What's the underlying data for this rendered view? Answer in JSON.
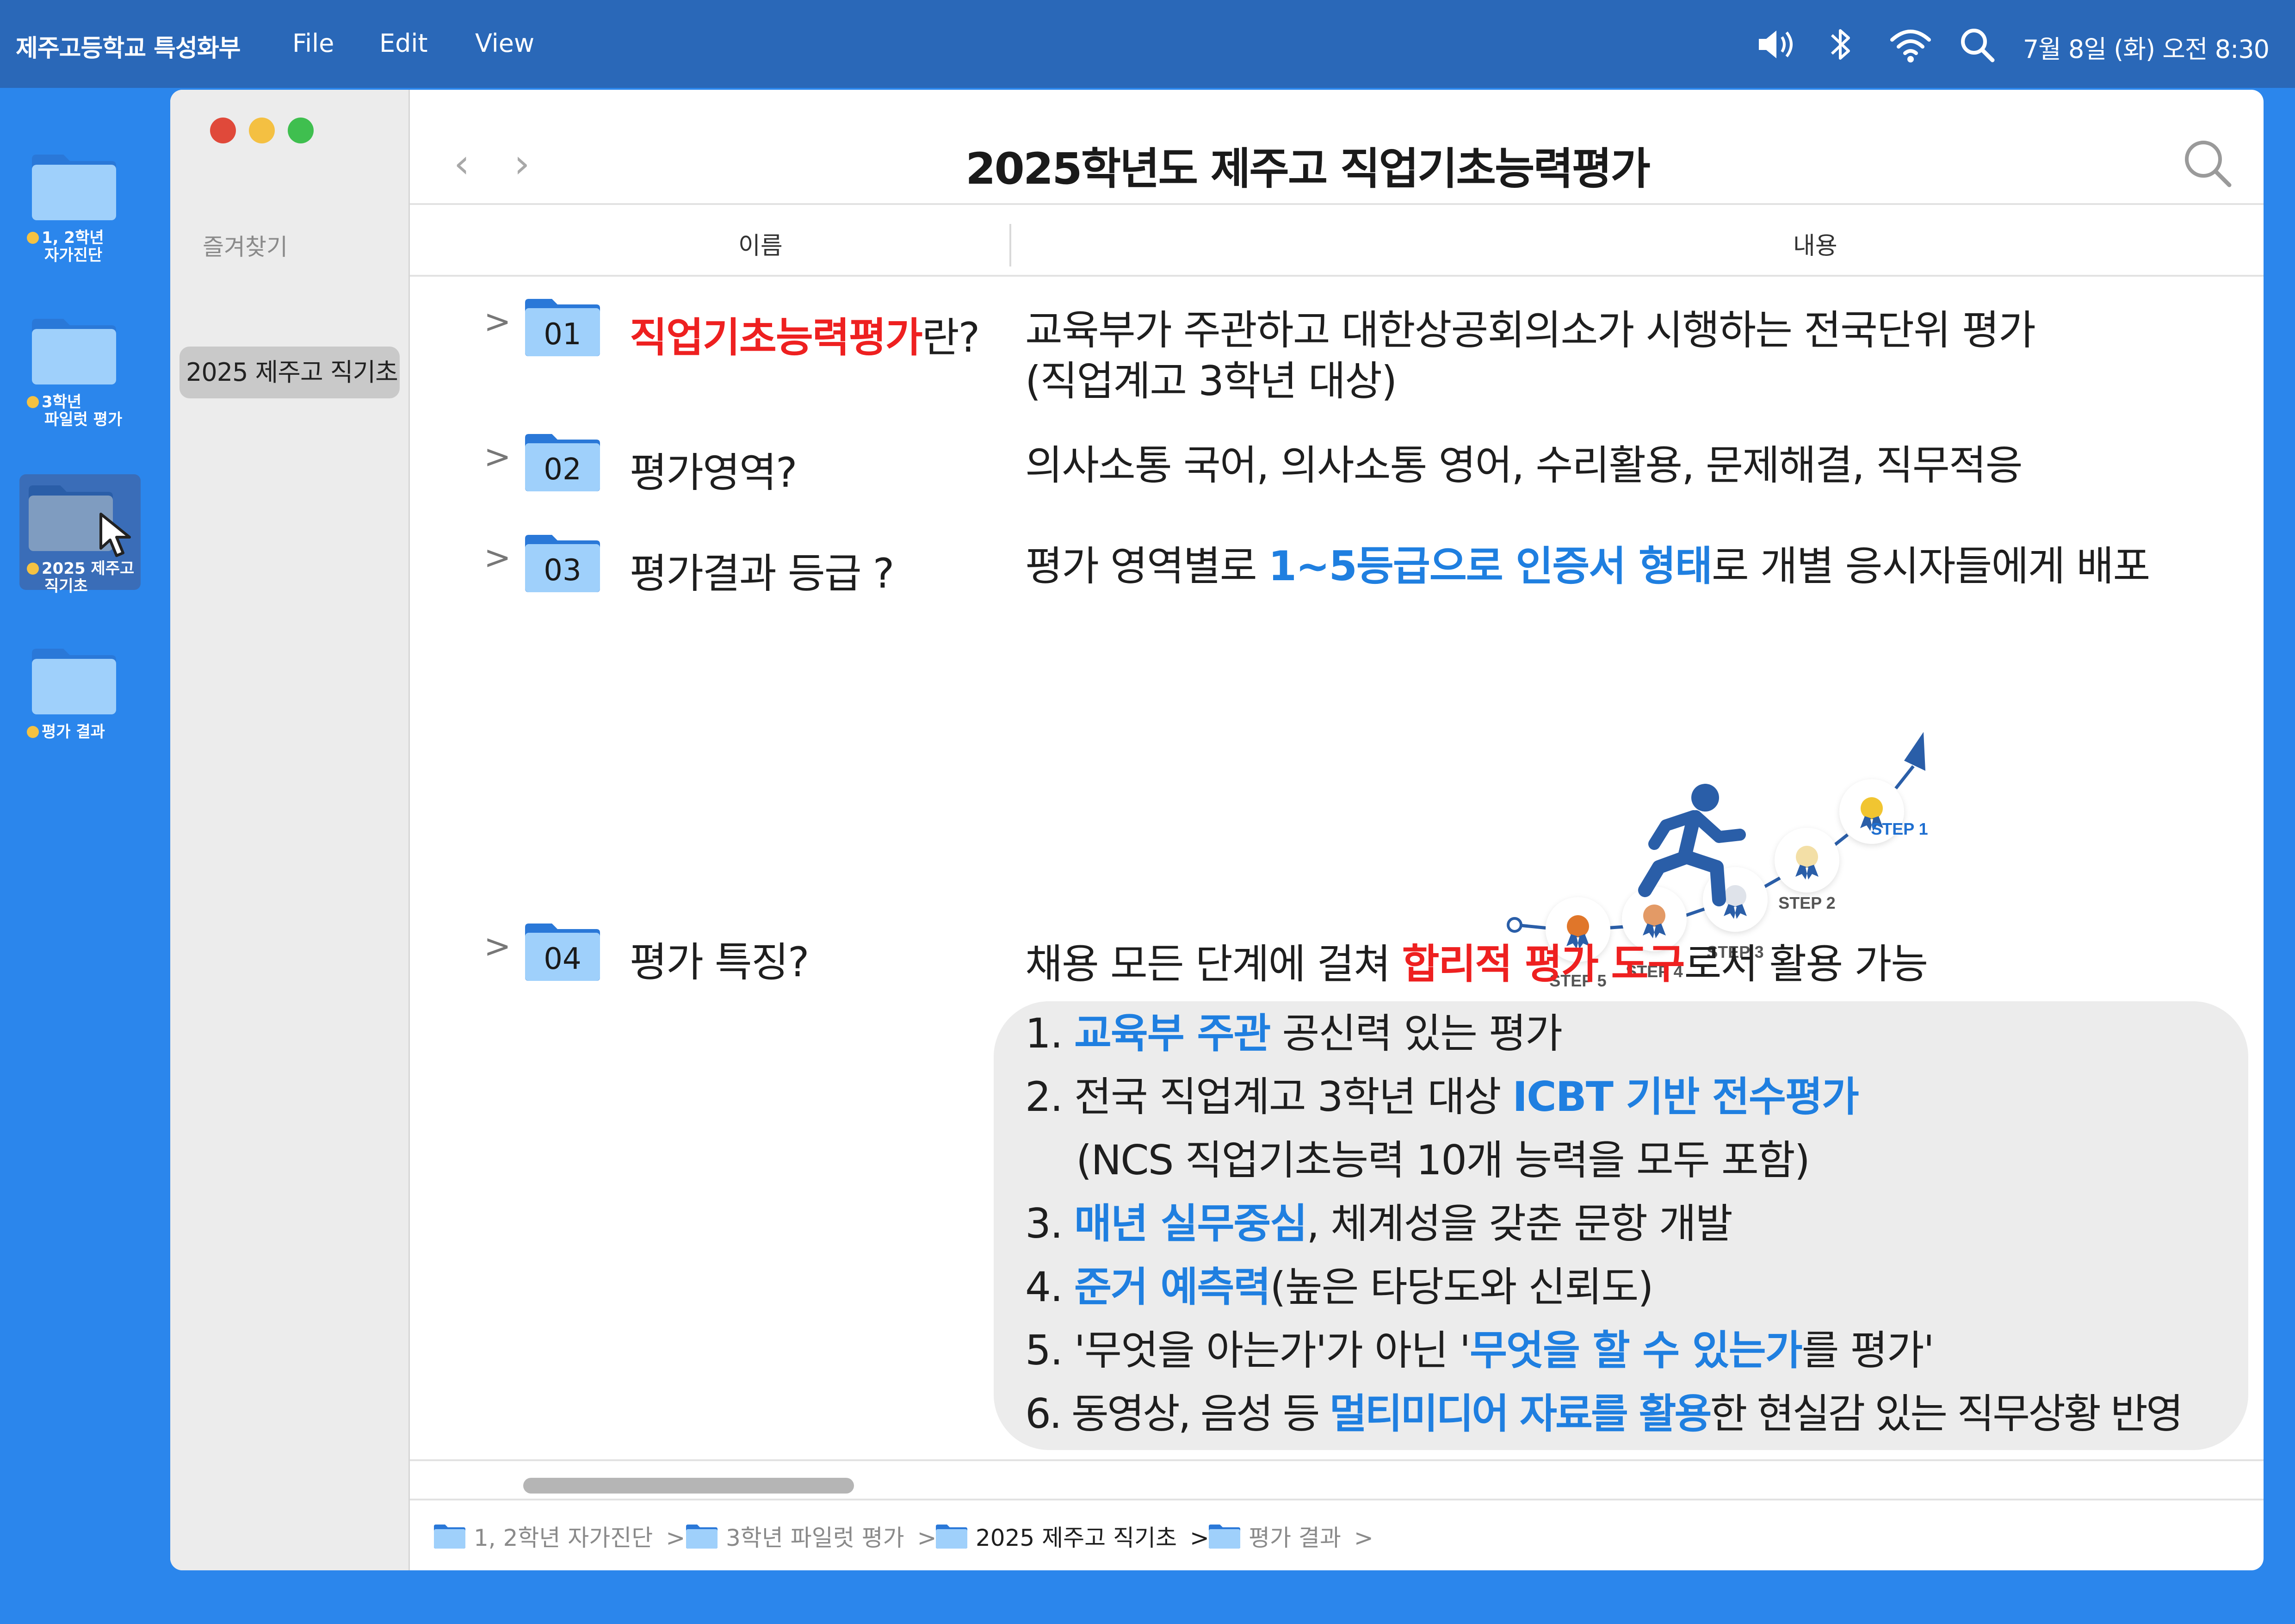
{
  "menubar": {
    "app_name": "제주고등학교 특성화부",
    "menus": [
      "File",
      "Edit",
      "View"
    ],
    "clock": "7월 8일 (화) 오전 8:30"
  },
  "desktop": {
    "icons": [
      {
        "label_lines": [
          "1, 2학년",
          "자가진단"
        ]
      },
      {
        "label_lines": [
          "3학년",
          "파일럿 평가"
        ]
      },
      {
        "label_lines": [
          "2025 제주고",
          "직기초"
        ],
        "selected": true
      },
      {
        "label_lines": [
          "평가 결과"
        ]
      }
    ]
  },
  "window": {
    "title": "2025학년도 제주고 직업기초능력평가",
    "sidebar": {
      "heading": "즐겨찾기",
      "item": "2025 제주고 직기초"
    },
    "columns": {
      "name": "이름",
      "content": "내용"
    },
    "rows": [
      {
        "num": "01",
        "name_red": "직업기초능력평가",
        "name_rest": "란?",
        "text_line1": "교육부가 주관하고 대한상공회의소가 시행하는 전국단위 평가",
        "text_line2": "(직업계고 3학년 대상)"
      },
      {
        "num": "02",
        "name": "평가영역?",
        "text": "의사소통 국어, 의사소통 영어, 수리활용, 문제해결, 직무적응"
      },
      {
        "num": "03",
        "name": "평가결과 등급 ?",
        "text_pre": "평가 영역별로 ",
        "text_hl": "1~5등급으로 인증서 형태",
        "text_post": "로 개별 응시자들에게 배포"
      },
      {
        "num": "04",
        "name": "평가 특징?",
        "text_pre": "채용 모든 단계에 걸쳐 ",
        "text_hl": "합리적 평가 도구",
        "text_post": "로서 활용 가능"
      }
    ],
    "steps": [
      "STEP 5",
      "STEP 4",
      "STEP 3",
      "STEP 2",
      "STEP 1"
    ],
    "features": [
      {
        "pre": "1. ",
        "hl": "교육부 주관",
        "post": " 공신력 있는 평가"
      },
      {
        "pre": "2. 전국 직업계고 3학년 대상 ",
        "hl": "ICBT 기반 전수평가",
        "post": ""
      },
      {
        "pre": "    (NCS 직업기초능력 10개 능력을 모두 포함)",
        "hl": "",
        "post": ""
      },
      {
        "pre": "3. ",
        "hl": "매년 실무중심",
        "post": ", 체계성을 갖춘 문항 개발"
      },
      {
        "pre": "4. ",
        "hl": "준거 예측력",
        "post": "(높은 타당도와 신뢰도)"
      },
      {
        "pre": "5. '무엇을 아는가'가 아닌 '",
        "hl": "무엇을 할 수 있는가",
        "post": "를 평가'"
      },
      {
        "pre": "6. 동영상, 음성 등 ",
        "hl": "멀티미디어 자료를 활용",
        "post": "한 현실감 있는 직무상황 반영"
      }
    ],
    "breadcrumb": [
      {
        "label": "1, 2학년 자가진단",
        "active": false
      },
      {
        "label": "3학년 파일럿 평가",
        "active": false
      },
      {
        "label": "2025 제주고 직기초",
        "active": true
      },
      {
        "label": "평가 결과",
        "active": false
      }
    ],
    "breadcrumb_sep": ">",
    "colors": {
      "accent_blue": "#1f7fe0",
      "accent_red": "#ee2020",
      "desktop": "#2b86ec",
      "menubar": "#2a68b8"
    }
  }
}
